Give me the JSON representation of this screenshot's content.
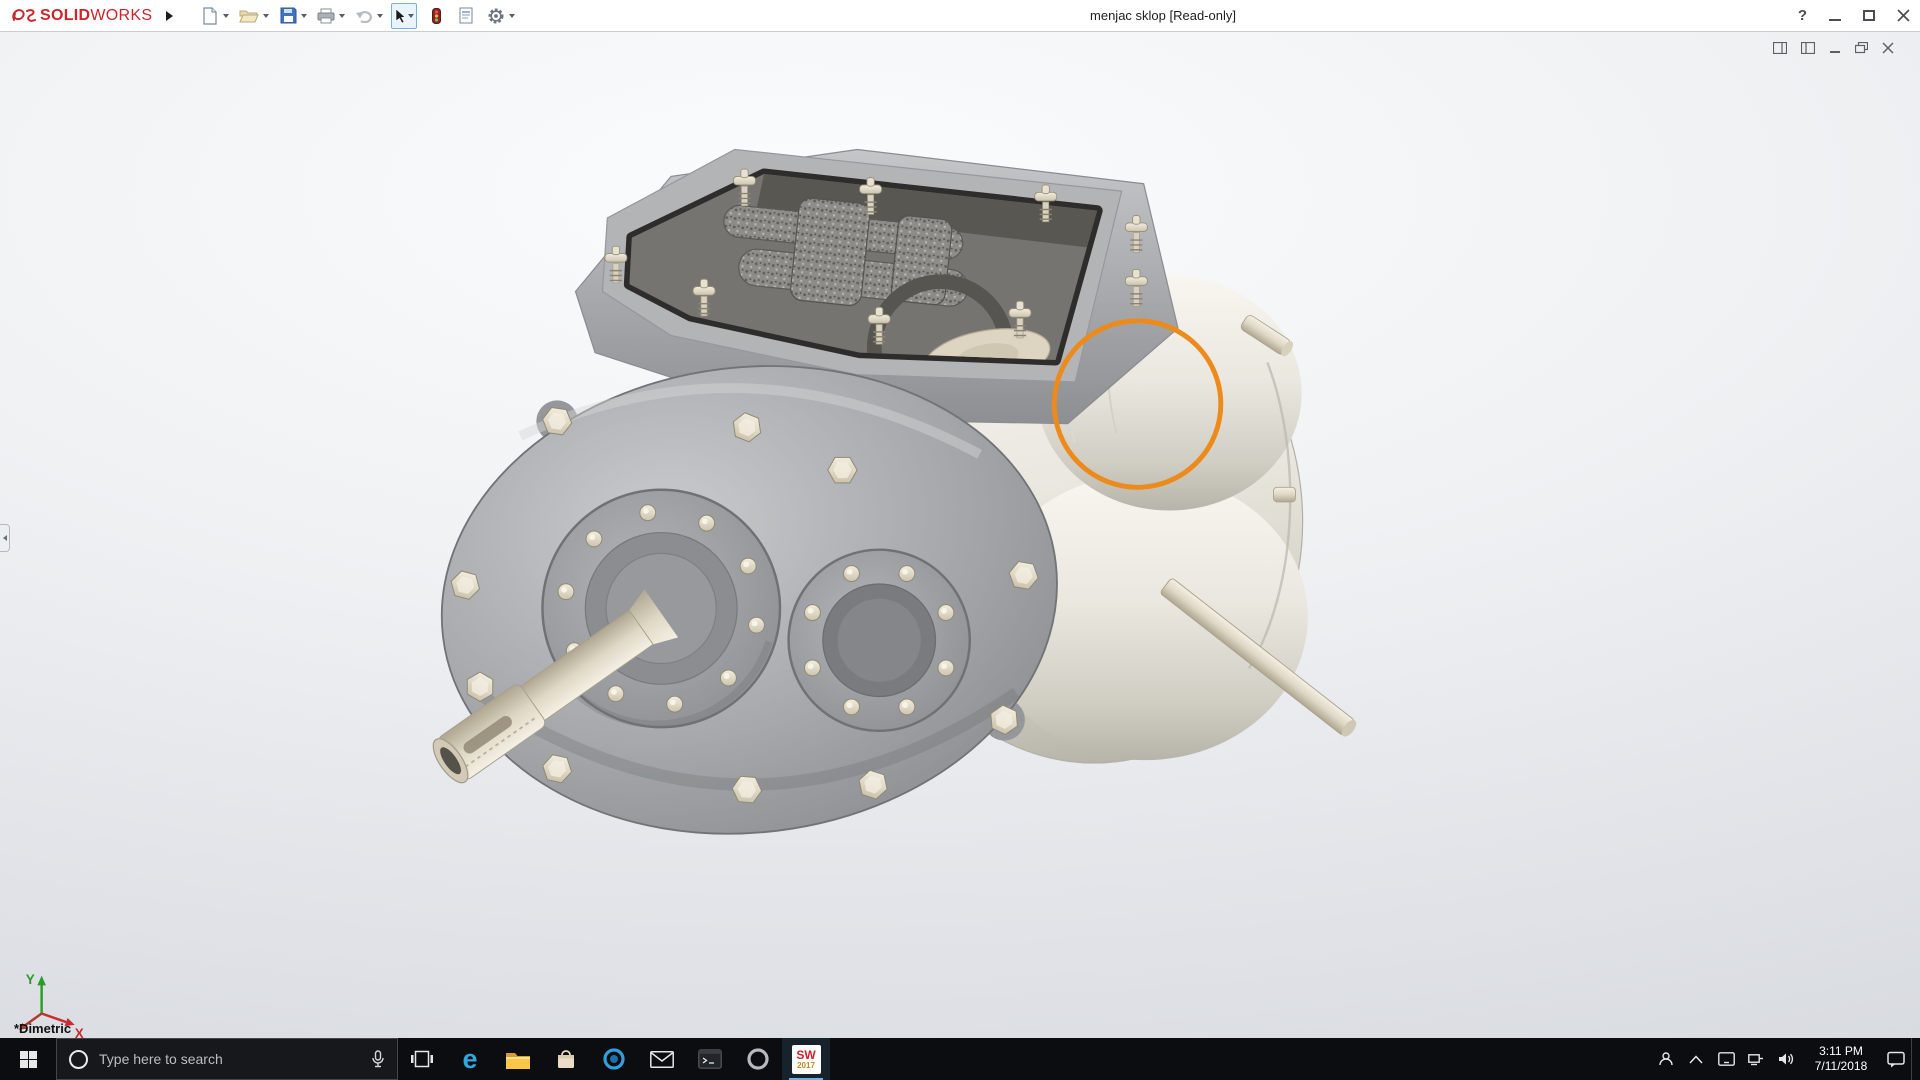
{
  "titlebar": {
    "brand": {
      "solid": "SOLID",
      "works": "WORKS"
    },
    "document_title": "menjac sklop [Read-only]",
    "help_label": "?"
  },
  "toolbar": {
    "icons": [
      "new-document",
      "open",
      "save",
      "print",
      "undo",
      "select-cursor",
      "rebuild-traffic-light",
      "file-properties",
      "options-gear"
    ]
  },
  "doc_window_controls": {
    "icons": [
      "pane-left",
      "pane-right",
      "minimize-doc",
      "restore-doc",
      "close-doc"
    ]
  },
  "viewport": {
    "view_orientation_label": "*Dimetric",
    "annotation": {
      "shape": "circle",
      "color": "#EC8B1B"
    },
    "triad": {
      "x_label": "X",
      "y_label": "Y"
    }
  },
  "taskbar": {
    "search_placeholder": "Type here to search",
    "edge_glyph": "e",
    "sw_badge": {
      "name": "SW",
      "year": "2017"
    },
    "clock": {
      "time": "3:11 PM",
      "date": "7/11/2018"
    },
    "app_icons": [
      "task-view",
      "edge",
      "file-explorer",
      "store-bag",
      "blue-ring-app",
      "mail",
      "terminal",
      "gray-ring-app",
      "solidworks-2017"
    ],
    "tray_icons": [
      "people",
      "chevron-up",
      "tablet",
      "network",
      "volume",
      "action-center"
    ]
  },
  "colors": {
    "brand_red": "#d0242b",
    "taskbar_bg": "#0c0d10",
    "annotation_orange": "#EC8B1B"
  }
}
